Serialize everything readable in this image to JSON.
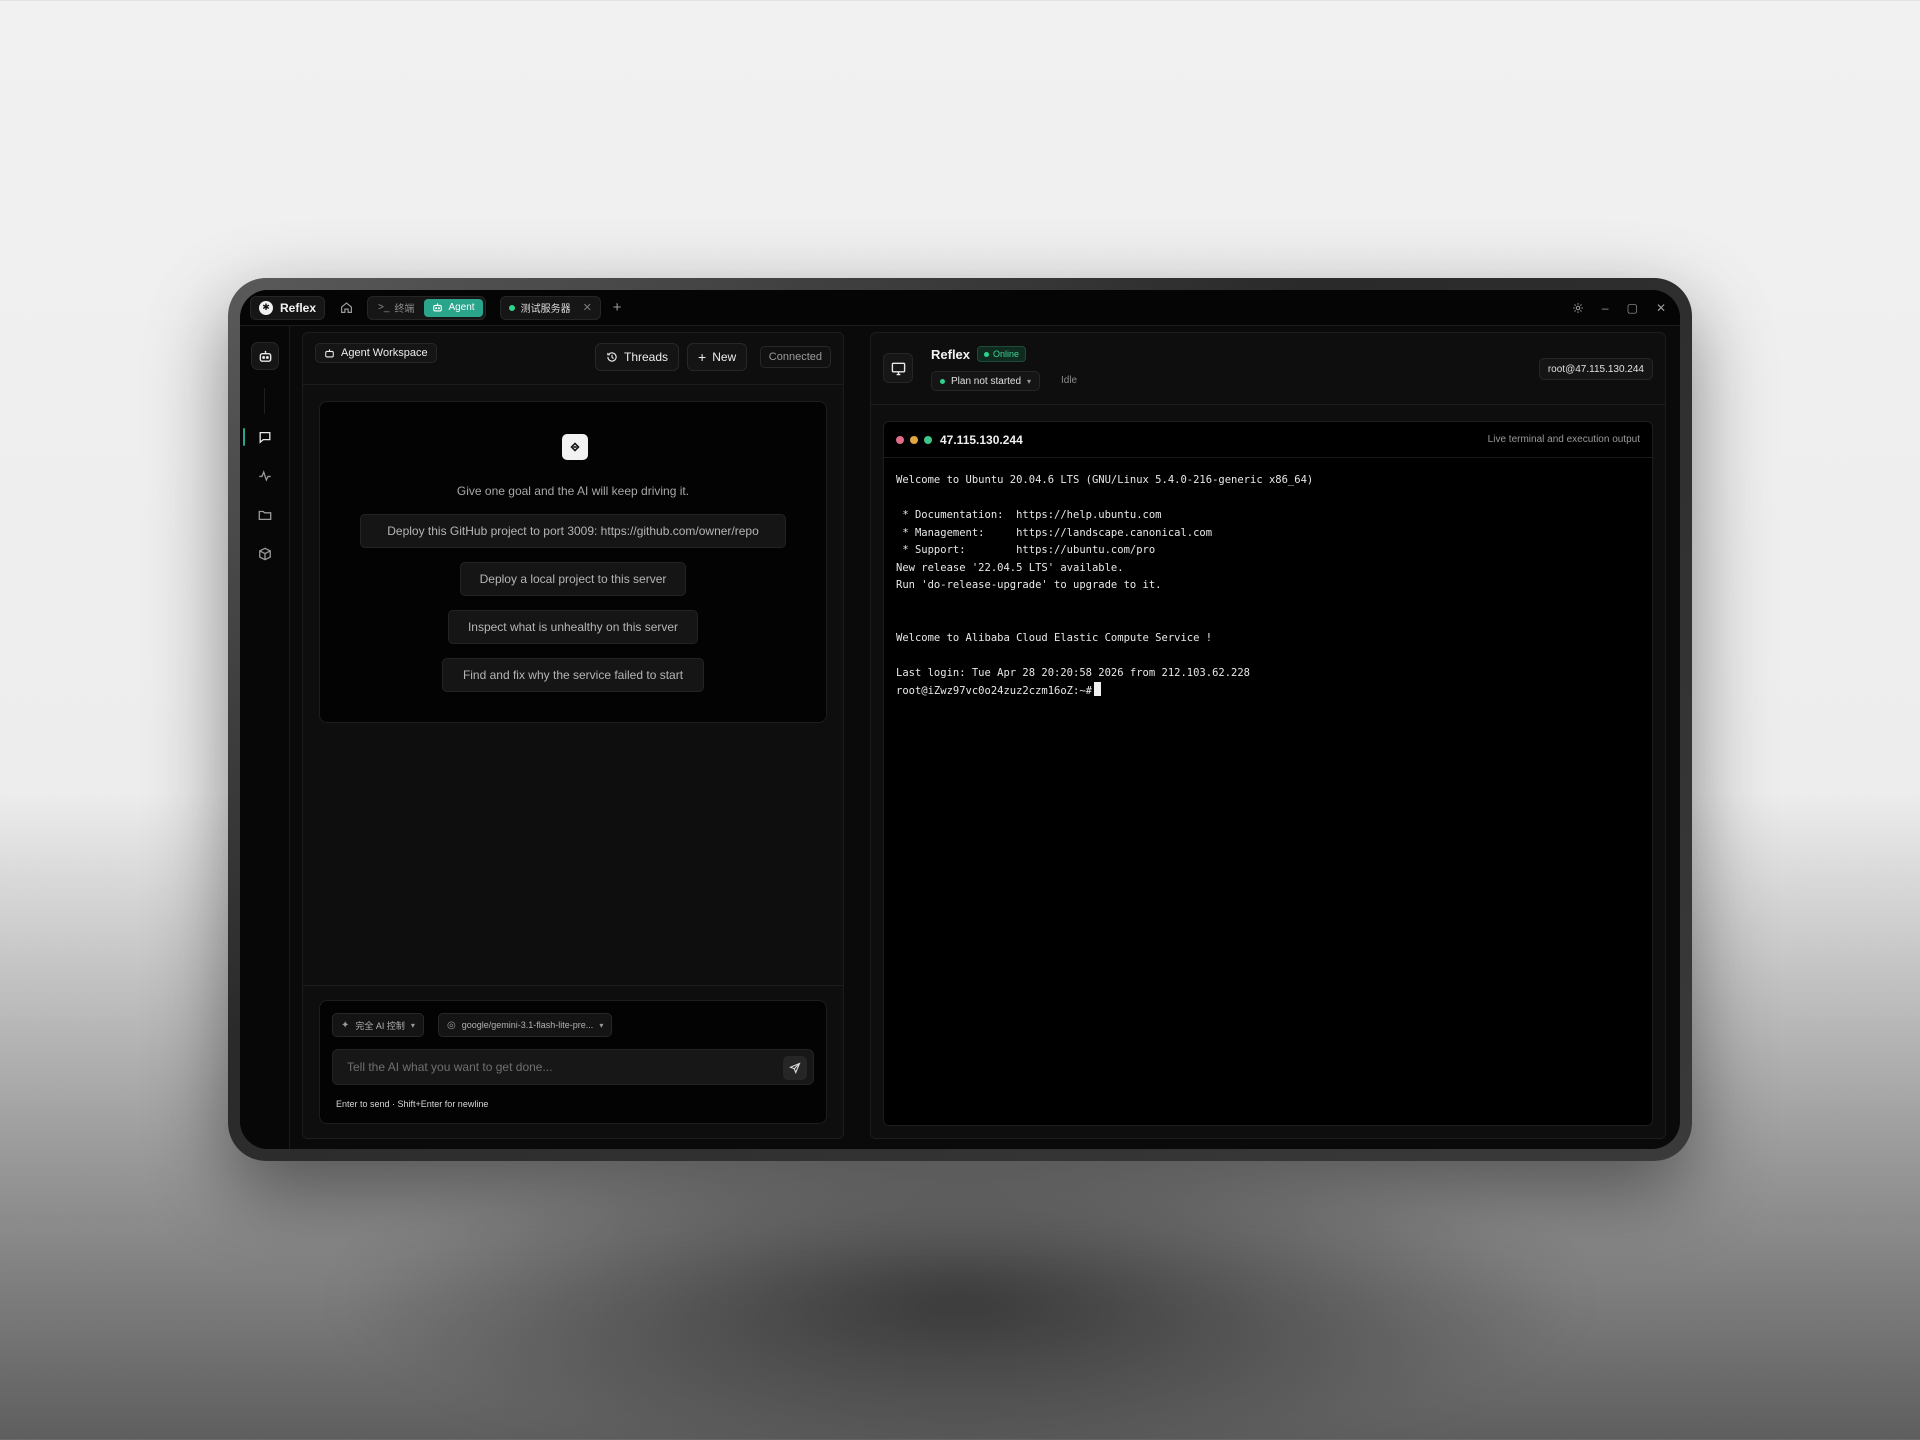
{
  "app": {
    "brand": "Reflex",
    "mode_tabs": [
      {
        "label": "终端",
        "active": false
      },
      {
        "label": "Agent",
        "active": true
      }
    ],
    "server_tab": {
      "label": "测试服务器",
      "status": "connected"
    },
    "accent_color": "#2aa58c"
  },
  "rail": {
    "items": [
      "agent-icon",
      "chat-icon",
      "activity-icon",
      "folder-icon",
      "package-icon"
    ],
    "active": "chat-icon"
  },
  "agent": {
    "workspace_label": "Agent Workspace",
    "threads_label": "Threads",
    "new_label": "New",
    "status": "Connected",
    "intro": "Give one goal and the AI will keep driving it.",
    "suggestions": [
      "Deploy this GitHub project to port 3009: https://github.com/owner/repo",
      "Deploy a local project to this server",
      "Inspect what is unhealthy on this server",
      "Find and fix why the service failed to start"
    ],
    "control_mode": "完全 AI 控制",
    "model": "google/gemini-3.1-flash-lite-pre...",
    "input_placeholder": "Tell the AI what you want to get done...",
    "hint": "Enter to send · Shift+Enter for newline"
  },
  "server": {
    "name": "Reflex",
    "online_label": "Online",
    "plan_label": "Plan not started",
    "state": "Idle",
    "host_label": "root@47.115.130.244",
    "terminal_title": "47.115.130.244",
    "terminal_subtitle": "Live terminal and execution output",
    "terminal_lines": [
      "Welcome to Ubuntu 20.04.6 LTS (GNU/Linux 5.4.0-216-generic x86_64)",
      "",
      " * Documentation:  https://help.ubuntu.com",
      " * Management:     https://landscape.canonical.com",
      " * Support:        https://ubuntu.com/pro",
      "New release '22.04.5 LTS' available.",
      "Run 'do-release-upgrade' to upgrade to it.",
      "",
      "",
      "Welcome to Alibaba Cloud Elastic Compute Service !",
      "",
      "Last login: Tue Apr 28 20:20:58 2026 from 212.103.62.228"
    ],
    "prompt": "root@iZwz97vc0o24zuz2czm16oZ:~#",
    "traffic_colors": [
      "#e06c8a",
      "#e0a640",
      "#3fc48a"
    ]
  }
}
